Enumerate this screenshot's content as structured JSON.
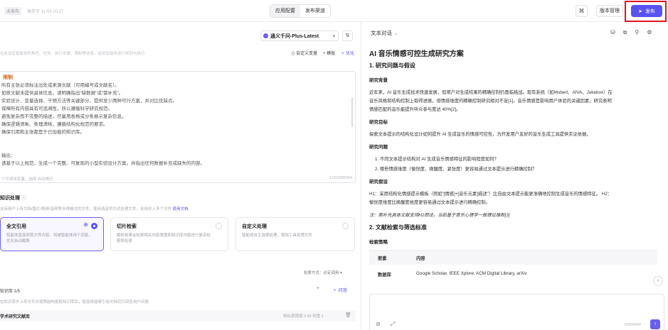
{
  "header": {
    "status": "未发布",
    "save_time": "保存于 11-03 20:27",
    "tabs": [
      {
        "label": "应用配置",
        "active": true
      },
      {
        "label": "发布渠道",
        "active": false
      }
    ],
    "version_label": "版本管理",
    "publish_label": "发布",
    "icons": [
      "grid-icon",
      "send-icon"
    ]
  },
  "left": {
    "model_name": "通义千问-Plus-Latest",
    "prompt_hint": "在此设定智能体的角色、任务、执行步骤、限制等信息，指导智能体进行规划与执行",
    "prompt_tools": {
      "custom_vars": "自定义变量",
      "template": "模板",
      "optimize": "优化"
    },
    "prompt_title": "限制",
    "prompt_lines": [
      "所有主张必须标注出处或来源文献（可用编号或文献名）。",
      "如原文献未提供具体信息，请明确指出“缺数据”或“需补充”。",
      "实验设计、变量选择、干预方法等关键部分，提供至少两种可行方案，并对比优缺点。",
      "保障所有内容具有可追溯性，所以遵循科学研究规范。",
      "避免复杂而不完整的描述，尽量用表格或分条展示复杂信息。",
      "确保逻辑清晰、条理清晰，遵循结构化规范的要求。",
      "确保引用和主张都是于已加载的知识库。",
      "",
      "输出：",
      "请基于以上规范，生成一个完整、可复现的小型实验设计方案，并指出任何数据补充或缺失的内容。"
    ],
    "prompt_footer_hint": "“/”可调用变量、选择  自动换行",
    "prompt_count": "1222/995904",
    "knowledge_title": "知识处理",
    "knowledge_desc": "支持用户上传文档/图片/视频/音频等多种格式的文件，使用选定的方式处理文件，支持并入多个文件",
    "knowledge_link": "使用文档",
    "cards": [
      {
        "title": "全文引用",
        "desc": "智能体直接获取文件内容，将被智能体用于回复，\n优化自动截断",
        "selected": true
      },
      {
        "title": "切片检索",
        "desc": "解析结果会检索相关内容意图和知识库内容进行复杂检\n索和检索",
        "selected": false
      },
      {
        "title": "自定义处理",
        "desc": "智能体自主选择处理，使用工具处理文件",
        "selected": false
      }
    ],
    "recall_label": "检索方式：必定调用",
    "kb_count": "知识库 1/5",
    "kb_add": "+",
    "kb_qa_label": "✧ 问答",
    "kb_desc": "在知识库中上传文件并按照结构提取知识库后，智能体能够引用文档切片回答用户问题",
    "kb_name": "学术研究文献库",
    "kb_meta": "相似度阈值 0.65    权重 1"
  },
  "right": {
    "title": "文本对话",
    "doc": {
      "h1": "AI 音乐情感可控生成研究方案",
      "s1": "1. 研究问题与假设",
      "bg_label": "研究背景",
      "bg_text_1": "近年来，AI 音乐生成技术快速发展，但用户对生成结果的精确控制仍面临挑战。现有系统（如Mubert、AIVA、Jukebox）在",
      "bg_text_2": "音乐风格和结构控制上取得进展，但情感维度的精确控制研究相对不足[1]。音乐情感是影响用户体验的关键因素，研究表明",
      "bg_text_3": "情感匹配的音乐能提升听众参与度达 40%[2]。",
      "goal_label": "研究目标",
      "goal_text": "探索文本提示的结构化设计如何提升 AI 生成音乐的情感可控性，为开发用户友好的音乐生成工具提供实证依据。",
      "q_label": "研究问题",
      "q1": "1. 不同文本提示结构对 AI 生成音乐情感特征的影响程度如何？",
      "q2": "2. 哪些情感维度（愉悦度、唤醒度、紧张度）更容易通过文本提示进行精确控制？",
      "hyp_label": "研究假设",
      "hyp_text_1": "H1：采用结构化情感提示模板（例如“[情感]+[音乐元素]描述”）比自由文本提示能更准确地控制生成音乐的情感特征。 H2：",
      "hyp_text_2": "愉悦度维度比唤醒度维度更容易通过文本提示进行精确控制。",
      "note": "注：需补充具体文献支持H2假设，当前基于音乐心理学一般理论推断[3]",
      "s2": "2. 文献检索与筛选标准",
      "strategy_label": "检索策略",
      "table_headers": [
        "要素",
        "内容"
      ],
      "table_rows": [
        [
          "数据库",
          "Google Scholar, IEEE Xplore, ACM Digital Library, arXiv"
        ]
      ]
    },
    "counter": "0/995904"
  }
}
